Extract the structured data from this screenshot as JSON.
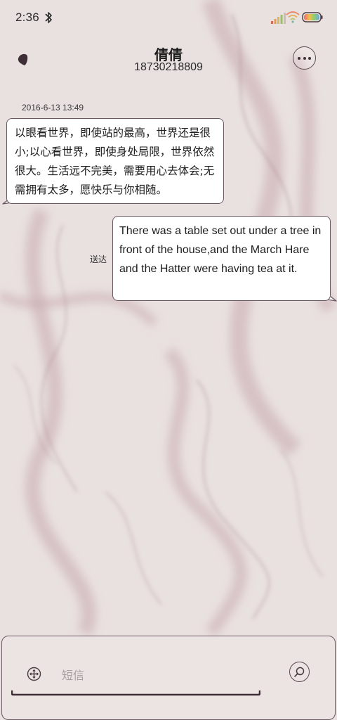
{
  "status_bar": {
    "time": "2:36"
  },
  "header": {
    "contact_name": "倩倩",
    "phone_number": "18730218809"
  },
  "conversation": {
    "timestamp": "2016-6-13 13:49",
    "messages": [
      {
        "direction": "incoming",
        "text": "以眼看世界，即使站的最高，世界还是很小;以心看世界，即使身处局限，世界依然很大。生活远不完美，需要用心去体会;无需拥有太多，愿快乐与你相随。"
      },
      {
        "direction": "outgoing",
        "text": "There was a table set out under a tree in front of the house,and the March Hare and the Hatter were having tea at it.",
        "status": "送达"
      }
    ]
  },
  "composer": {
    "placeholder": "短信"
  },
  "colors": {
    "background": "#e9e1df",
    "bubble": "#ffffff",
    "bubble_border": "#6a5860",
    "accent_dark": "#4a3b40"
  },
  "icons": {
    "back": "back-arrow-icon",
    "more": "more-dots-icon",
    "add": "add-circle-icon",
    "send": "search-send-icon"
  }
}
